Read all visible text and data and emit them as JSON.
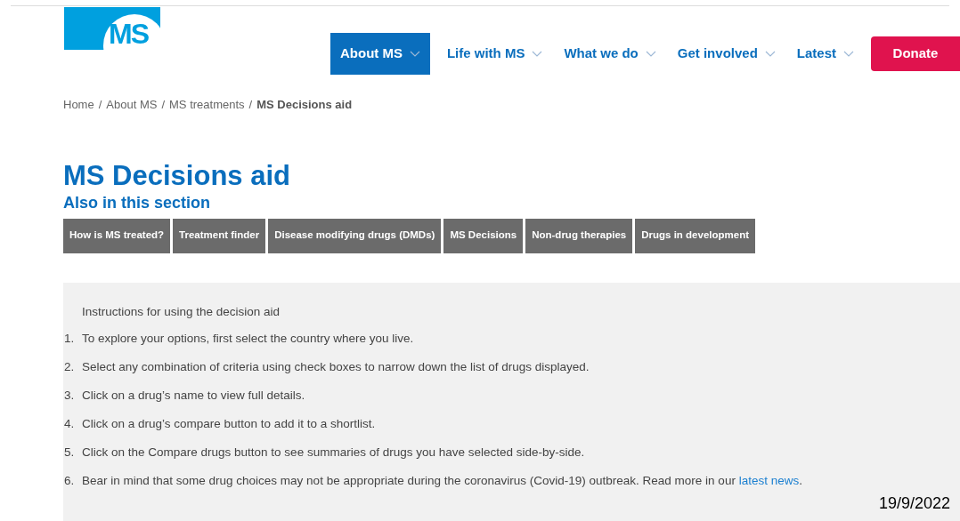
{
  "logo": {
    "text": "MS"
  },
  "nav": [
    {
      "label": "About MS",
      "selected": true
    },
    {
      "label": "Life with MS",
      "selected": false
    },
    {
      "label": "What we do",
      "selected": false
    },
    {
      "label": "Get involved",
      "selected": false
    },
    {
      "label": "Latest",
      "selected": false
    }
  ],
  "donate_button": "Donate",
  "breadcrumb": [
    {
      "label": "Home",
      "current": false
    },
    {
      "label": "About MS",
      "current": false
    },
    {
      "label": "MS treatments",
      "current": false
    },
    {
      "label": "MS Decisions aid",
      "current": true
    }
  ],
  "breadcrumb_separator": "/",
  "title": "MS Decisions aid",
  "section_heading": "Also in this section",
  "section_tabs": [
    "How is MS treated?",
    "Treatment finder",
    "Disease modifying drugs (DMDs)",
    "MS Decisions",
    "Non-drug therapies",
    "Drugs in development"
  ],
  "instructions": {
    "heading": "Instructions for using the decision aid",
    "steps": [
      {
        "number": "1.",
        "text": "To explore your options, first select the country where you live."
      },
      {
        "number": "2.",
        "text": "Select any combination of criteria using check boxes to narrow down the list of drugs displayed."
      },
      {
        "number": "3.",
        "text": "Click on a drug’s name to view full details."
      },
      {
        "number": "4.",
        "text": "Click on a drug’s compare button to add it to a shortlist."
      },
      {
        "number": "5.",
        "text": "Click on the Compare drugs button to see summaries of drugs you have selected side-by-side."
      },
      {
        "number": "6.",
        "text": "Bear in mind that some drug choices may not be appropriate during the coronavirus (Covid-19) outbreak. Read more in our",
        "link": "latest news",
        "after_link": "."
      }
    ]
  },
  "date": "19/9/2022"
}
